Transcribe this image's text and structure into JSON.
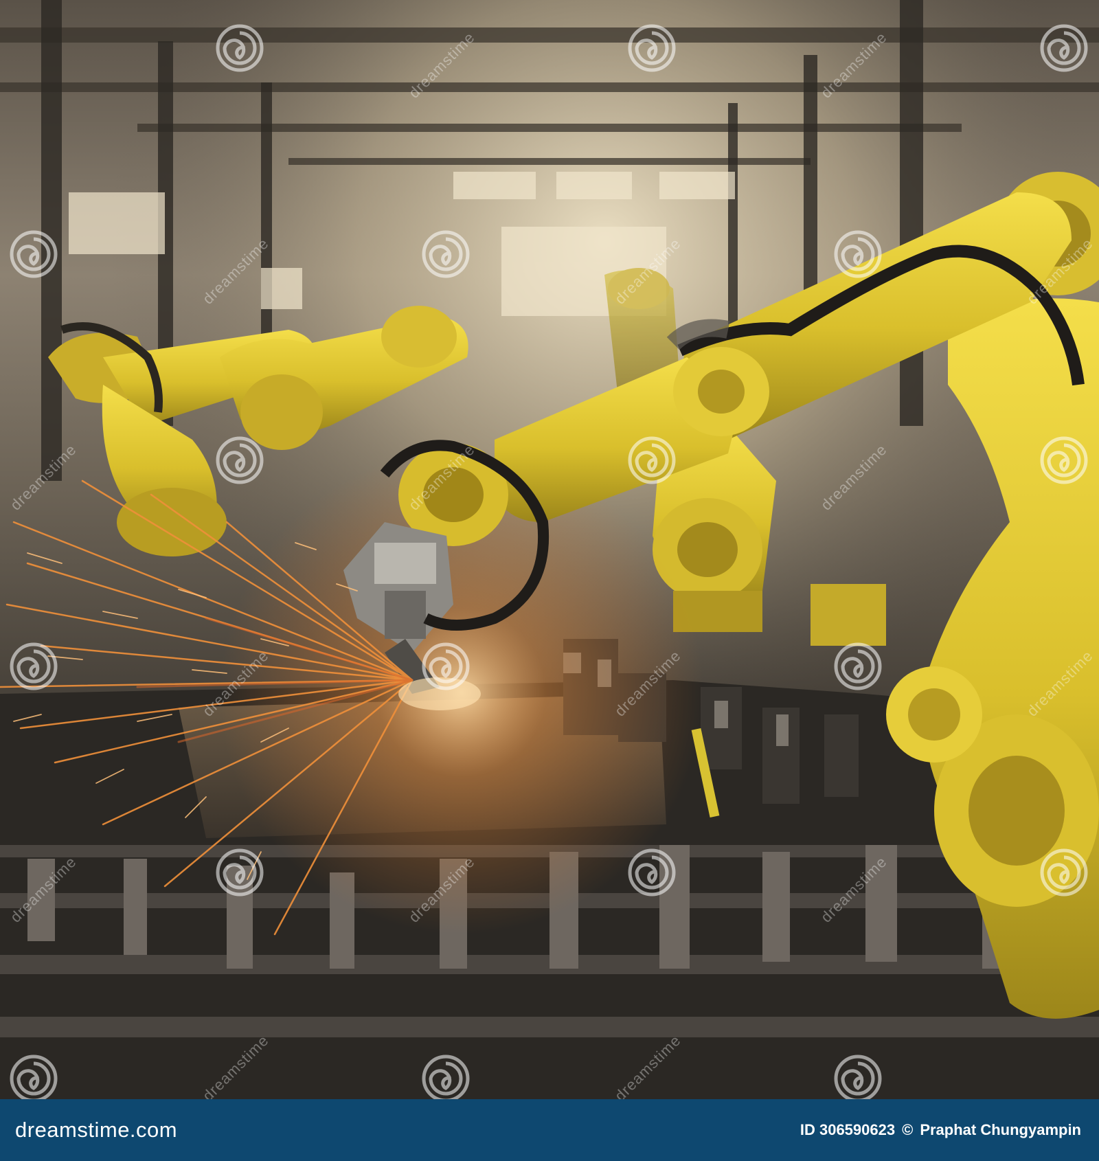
{
  "watermark": {
    "brand_text": "dreamstime",
    "logo_icon": "dreamstime-swirl-icon"
  },
  "footer": {
    "site": "dreamstime.com",
    "image_id": "ID 306590623",
    "copyright_symbol": "©",
    "author": "Praphat Chungyampin",
    "background_color": "#0e4870"
  },
  "scene": {
    "subject": "yellow industrial robotic arms welding on a factory assembly line with flying sparks",
    "colors": {
      "robot_yellow": "#e0c632",
      "spark_orange": "#e07a2a",
      "steel_dark": "#2e2b27",
      "haze": "#cfc2a8"
    }
  }
}
